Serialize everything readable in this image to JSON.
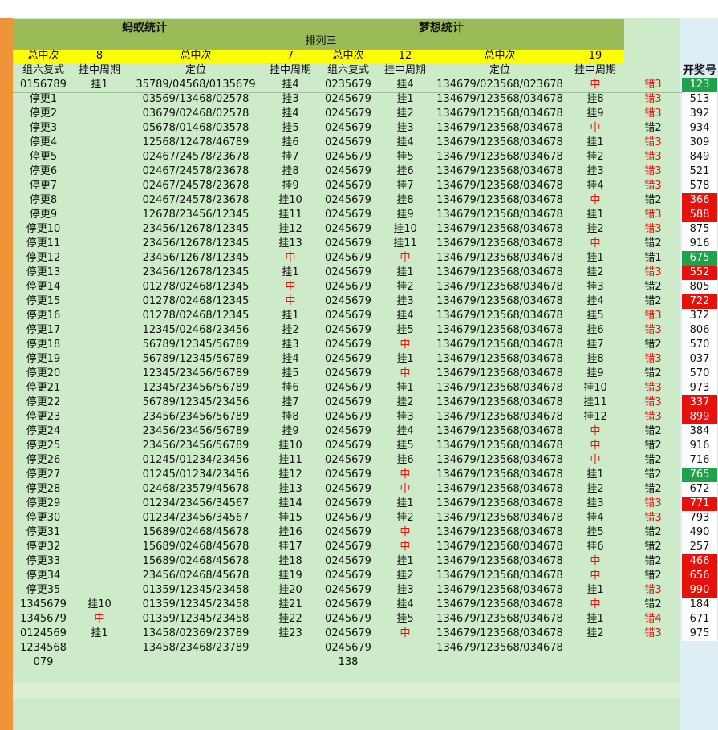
{
  "header": {
    "ant": "蚂蚁统计",
    "dream": "梦想统计",
    "subtitle": "排列三",
    "total_label": "总中次",
    "ant_total_1": "8",
    "ant_total_2": "7",
    "dream_total_1": "12",
    "dream_total_2": "19",
    "draw_label": "开奖号"
  },
  "columns": [
    "组六复式",
    "挂中周期",
    "定位",
    "挂中周期",
    "组六复式",
    "挂中周期",
    "定位",
    "挂中周期"
  ],
  "rows": [
    [
      "0156789",
      "挂1",
      "35789/04568/0135679",
      "挂4",
      "0235679",
      "挂4",
      "134679/023568/023678",
      "中",
      "错3",
      "123",
      "g"
    ],
    [
      "停更1",
      "",
      "03569/13468/02578",
      "挂3",
      "0245679",
      "挂1",
      "134679/123568/034678",
      "挂8",
      "错3",
      "513",
      ""
    ],
    [
      "停更2",
      "",
      "03679/02468/02578",
      "挂4",
      "0245679",
      "挂2",
      "134679/123568/034678",
      "挂9",
      "错3",
      "392",
      ""
    ],
    [
      "停更3",
      "",
      "05678/01468/03578",
      "挂5",
      "0245679",
      "挂3",
      "134679/123568/034678",
      "中",
      "错2",
      "934",
      ""
    ],
    [
      "停更4",
      "",
      "12568/12478/46789",
      "挂6",
      "0245679",
      "挂4",
      "134679/123568/034678",
      "挂1",
      "错3",
      "309",
      ""
    ],
    [
      "停更5",
      "",
      "02467/24578/23678",
      "挂7",
      "0245679",
      "挂5",
      "134679/123568/034678",
      "挂2",
      "错3",
      "849",
      ""
    ],
    [
      "停更6",
      "",
      "02467/24578/23678",
      "挂8",
      "0245679",
      "挂6",
      "134679/123568/034678",
      "挂3",
      "错3",
      "521",
      ""
    ],
    [
      "停更7",
      "",
      "02467/24578/23678",
      "挂9",
      "0245679",
      "挂7",
      "134679/123568/034678",
      "挂4",
      "错3",
      "578",
      ""
    ],
    [
      "停更8",
      "",
      "02467/24578/23678",
      "挂10",
      "0245679",
      "挂8",
      "134679/123568/034678",
      "中",
      "错2",
      "366",
      "r"
    ],
    [
      "停更9",
      "",
      "12678/23456/12345",
      "挂11",
      "0245679",
      "挂9",
      "134679/123568/034678",
      "挂1",
      "错3",
      "588",
      "r"
    ],
    [
      "停更10",
      "",
      "23456/12678/12345",
      "挂12",
      "0245679",
      "挂10",
      "134679/123568/034678",
      "挂2",
      "错3",
      "875",
      ""
    ],
    [
      "停更11",
      "",
      "23456/12678/12345",
      "挂13",
      "0245679",
      "挂11",
      "134679/123568/034678",
      "中",
      "错2",
      "916",
      ""
    ],
    [
      "停更12",
      "",
      "23456/12678/12345",
      "中",
      "0245679",
      "中",
      "134679/123568/034678",
      "挂1",
      "错1",
      "675",
      "g"
    ],
    [
      "停更13",
      "",
      "23456/12678/12345",
      "挂1",
      "0245679",
      "挂1",
      "134679/123568/034678",
      "挂2",
      "错3",
      "552",
      "r"
    ],
    [
      "停更14",
      "",
      "01278/02468/12345",
      "中",
      "0245679",
      "挂2",
      "134679/123568/034678",
      "挂3",
      "错2",
      "805",
      ""
    ],
    [
      "停更15",
      "",
      "01278/02468/12345",
      "中",
      "0245679",
      "挂3",
      "134679/123568/034678",
      "挂4",
      "错2",
      "722",
      "r"
    ],
    [
      "停更16",
      "",
      "01278/02468/12345",
      "挂1",
      "0245679",
      "挂4",
      "134679/123568/034678",
      "挂5",
      "错3",
      "372",
      ""
    ],
    [
      "停更17",
      "",
      "12345/02468/23456",
      "挂2",
      "0245679",
      "挂5",
      "134679/123568/034678",
      "挂6",
      "错3",
      "806",
      ""
    ],
    [
      "停更18",
      "",
      "56789/12345/56789",
      "挂3",
      "0245679",
      "中",
      "134679/123568/034678",
      "挂7",
      "错2",
      "570",
      ""
    ],
    [
      "停更19",
      "",
      "56789/12345/56789",
      "挂4",
      "0245679",
      "挂1",
      "134679/123568/034678",
      "挂8",
      "错3",
      "037",
      ""
    ],
    [
      "停更20",
      "",
      "12345/23456/56789",
      "挂5",
      "0245679",
      "中",
      "134679/123568/034678",
      "挂9",
      "错2",
      "570",
      ""
    ],
    [
      "停更21",
      "",
      "12345/23456/56789",
      "挂6",
      "0245679",
      "挂1",
      "134679/123568/034678",
      "挂10",
      "错3",
      "973",
      ""
    ],
    [
      "停更22",
      "",
      "56789/12345/23456",
      "挂7",
      "0245679",
      "挂2",
      "134679/123568/034678",
      "挂11",
      "错3",
      "337",
      "r"
    ],
    [
      "停更23",
      "",
      "23456/23456/56789",
      "挂8",
      "0245679",
      "挂3",
      "134679/123568/034678",
      "挂12",
      "错3",
      "899",
      "r"
    ],
    [
      "停更24",
      "",
      "23456/23456/56789",
      "挂9",
      "0245679",
      "挂4",
      "134679/123568/034678",
      "中",
      "错2",
      "384",
      ""
    ],
    [
      "停更25",
      "",
      "23456/23456/56789",
      "挂10",
      "0245679",
      "挂5",
      "134679/123568/034678",
      "中",
      "错2",
      "916",
      ""
    ],
    [
      "停更26",
      "",
      "01245/01234/23456",
      "挂11",
      "0245679",
      "挂6",
      "134679/123568/034678",
      "中",
      "错2",
      "716",
      ""
    ],
    [
      "停更27",
      "",
      "01245/01234/23456",
      "挂12",
      "0245679",
      "中",
      "134679/123568/034678",
      "挂1",
      "错2",
      "765",
      "g"
    ],
    [
      "停更28",
      "",
      "02468/23579/45678",
      "挂13",
      "0245679",
      "中",
      "134679/123568/034678",
      "挂2",
      "错2",
      "672",
      ""
    ],
    [
      "停更29",
      "",
      "01234/23456/34567",
      "挂14",
      "0245679",
      "挂1",
      "134679/123568/034678",
      "挂3",
      "错3",
      "771",
      "r"
    ],
    [
      "停更30",
      "",
      "01234/23456/34567",
      "挂15",
      "0245679",
      "挂2",
      "134679/123568/034678",
      "挂4",
      "错3",
      "793",
      ""
    ],
    [
      "停更31",
      "",
      "15689/02468/45678",
      "挂16",
      "0245679",
      "中",
      "134679/123568/034678",
      "挂5",
      "错2",
      "490",
      ""
    ],
    [
      "停更32",
      "",
      "15689/02468/45678",
      "挂17",
      "0245679",
      "中",
      "134679/123568/034678",
      "挂6",
      "错2",
      "257",
      ""
    ],
    [
      "停更33",
      "",
      "15689/02468/45678",
      "挂18",
      "0245679",
      "挂1",
      "134679/123568/034678",
      "中",
      "错2",
      "466",
      "r"
    ],
    [
      "停更34",
      "",
      "23456/02468/45678",
      "挂19",
      "0245679",
      "挂2",
      "134679/123568/034678",
      "中",
      "错2",
      "656",
      "r"
    ],
    [
      "停更35",
      "",
      "01359/12345/23458",
      "挂20",
      "0245679",
      "挂3",
      "134679/123568/034678",
      "挂1",
      "错3",
      "990",
      "r"
    ],
    [
      "1345679",
      "挂10",
      "01359/12345/23458",
      "挂21",
      "0245679",
      "挂4",
      "134679/123568/034678",
      "中",
      "错2",
      "184",
      ""
    ],
    [
      "1345679",
      "中",
      "01359/12345/23458",
      "挂22",
      "0245679",
      "挂5",
      "134679/123568/034678",
      "挂1",
      "错4",
      "671",
      ""
    ],
    [
      "0124569",
      "挂1",
      "13458/02369/23789",
      "挂23",
      "0245679",
      "中",
      "134679/123568/034678",
      "挂2",
      "错3",
      "975",
      ""
    ],
    [
      "1234568",
      "",
      "13458/23468/23789",
      "",
      "0245679",
      "",
      "134679/123568/034678",
      "",
      "",
      "",
      ""
    ],
    [
      "079",
      "",
      "",
      "",
      "138",
      "",
      "",
      "",
      "",
      "",
      ""
    ]
  ],
  "colors": {
    "highlight_red": "#e8100b",
    "highlight_green": "#1fa24a",
    "header_green": "#9bbb59",
    "yellow": "#ffff00"
  }
}
